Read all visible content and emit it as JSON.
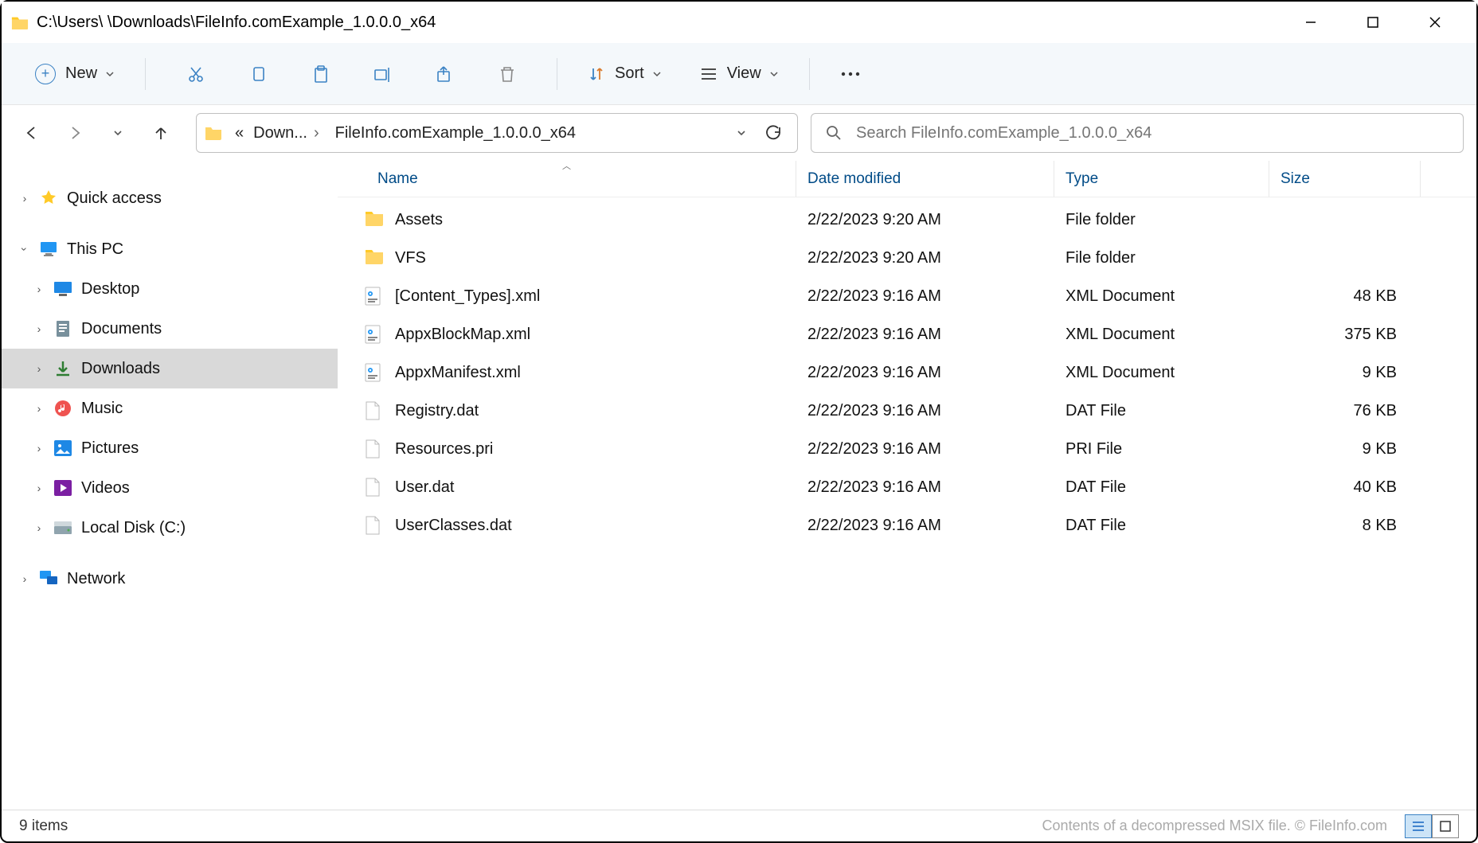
{
  "window": {
    "title": "C:\\Users\\            \\Downloads\\FileInfo.comExample_1.0.0.0_x64"
  },
  "toolbar": {
    "new_label": "New",
    "sort_label": "Sort",
    "view_label": "View"
  },
  "breadcrumb": {
    "parent": "Down...",
    "current": "FileInfo.comExample_1.0.0.0_x64"
  },
  "search": {
    "placeholder": "Search FileInfo.comExample_1.0.0.0_x64"
  },
  "sidebar": {
    "quick_access": "Quick access",
    "this_pc": "This PC",
    "items": [
      {
        "label": "Desktop"
      },
      {
        "label": "Documents"
      },
      {
        "label": "Downloads"
      },
      {
        "label": "Music"
      },
      {
        "label": "Pictures"
      },
      {
        "label": "Videos"
      },
      {
        "label": "Local Disk (C:)"
      }
    ],
    "network": "Network"
  },
  "columns": {
    "name": "Name",
    "date": "Date modified",
    "type": "Type",
    "size": "Size"
  },
  "files": [
    {
      "name": "Assets",
      "date": "2/22/2023 9:20 AM",
      "type": "File folder",
      "size": "",
      "icon": "folder"
    },
    {
      "name": "VFS",
      "date": "2/22/2023 9:20 AM",
      "type": "File folder",
      "size": "",
      "icon": "folder"
    },
    {
      "name": "[Content_Types].xml",
      "date": "2/22/2023 9:16 AM",
      "type": "XML Document",
      "size": "48 KB",
      "icon": "xml"
    },
    {
      "name": "AppxBlockMap.xml",
      "date": "2/22/2023 9:16 AM",
      "type": "XML Document",
      "size": "375 KB",
      "icon": "xml"
    },
    {
      "name": "AppxManifest.xml",
      "date": "2/22/2023 9:16 AM",
      "type": "XML Document",
      "size": "9 KB",
      "icon": "xml"
    },
    {
      "name": "Registry.dat",
      "date": "2/22/2023 9:16 AM",
      "type": "DAT File",
      "size": "76 KB",
      "icon": "file"
    },
    {
      "name": "Resources.pri",
      "date": "2/22/2023 9:16 AM",
      "type": "PRI File",
      "size": "9 KB",
      "icon": "file"
    },
    {
      "name": "User.dat",
      "date": "2/22/2023 9:16 AM",
      "type": "DAT File",
      "size": "40 KB",
      "icon": "file"
    },
    {
      "name": "UserClasses.dat",
      "date": "2/22/2023 9:16 AM",
      "type": "DAT File",
      "size": "8 KB",
      "icon": "file"
    }
  ],
  "status": {
    "left": "9 items",
    "right": "Contents of a decompressed MSIX file. © FileInfo.com"
  }
}
